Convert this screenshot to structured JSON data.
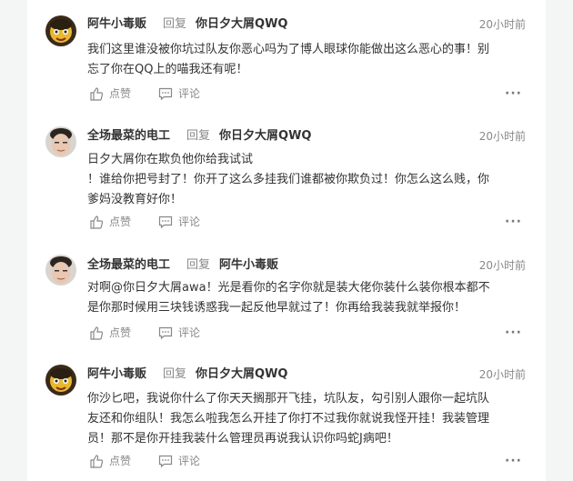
{
  "ui": {
    "reply_word": "回复",
    "like_label": "点赞",
    "comment_label": "评论",
    "more_label": "···"
  },
  "comments": [
    {
      "user": "阿牛小毒贩",
      "reply_to": "你日夕大屑QWQ",
      "time": "20小时前",
      "lines": [
        "我们这里谁没被你坑过队友你恶心吗为了博人眼球你能做出这么恶心的事！别",
        "忘了你在QQ上的喵我还有呢！"
      ],
      "avatar_style": "yellow-cartoon"
    },
    {
      "user": "全场最菜的电工",
      "reply_to": "你日夕大屑QWQ",
      "time": "20小时前",
      "lines": [
        "日夕大屑你在欺负他你给我试试",
        "！谁给你把号封了！你开了这么多挂我们谁都被你欺负过！你怎么这么贱，你",
        "爹妈没教育好你！"
      ],
      "avatar_style": "photo-face"
    },
    {
      "user": "全场最菜的电工",
      "reply_to": "阿牛小毒贩",
      "time": "20小时前",
      "lines": [
        "对啊@你日夕大屑awa！光是看你的名字你就是装大佬你装什么装你根本都不",
        "是你那时候用三块钱诱惑我一起反他早就过了！你再给我装我就举报你！"
      ],
      "avatar_style": "photo-face"
    },
    {
      "user": "阿牛小毒贩",
      "reply_to": "你日夕大屑QWQ",
      "time": "20小时前",
      "lines": [
        "你沙匕吧，我说你什么了你天天搁那开飞挂，坑队友，勾引别人跟你一起坑队",
        "友还和你组队！我怎么啦我怎么开挂了你打不过我你就说我怪开挂！我装管理",
        "员！那不是你开挂我装什么管理员再说我认识你吗蛇J病吧！"
      ],
      "avatar_style": "yellow-cartoon"
    }
  ]
}
